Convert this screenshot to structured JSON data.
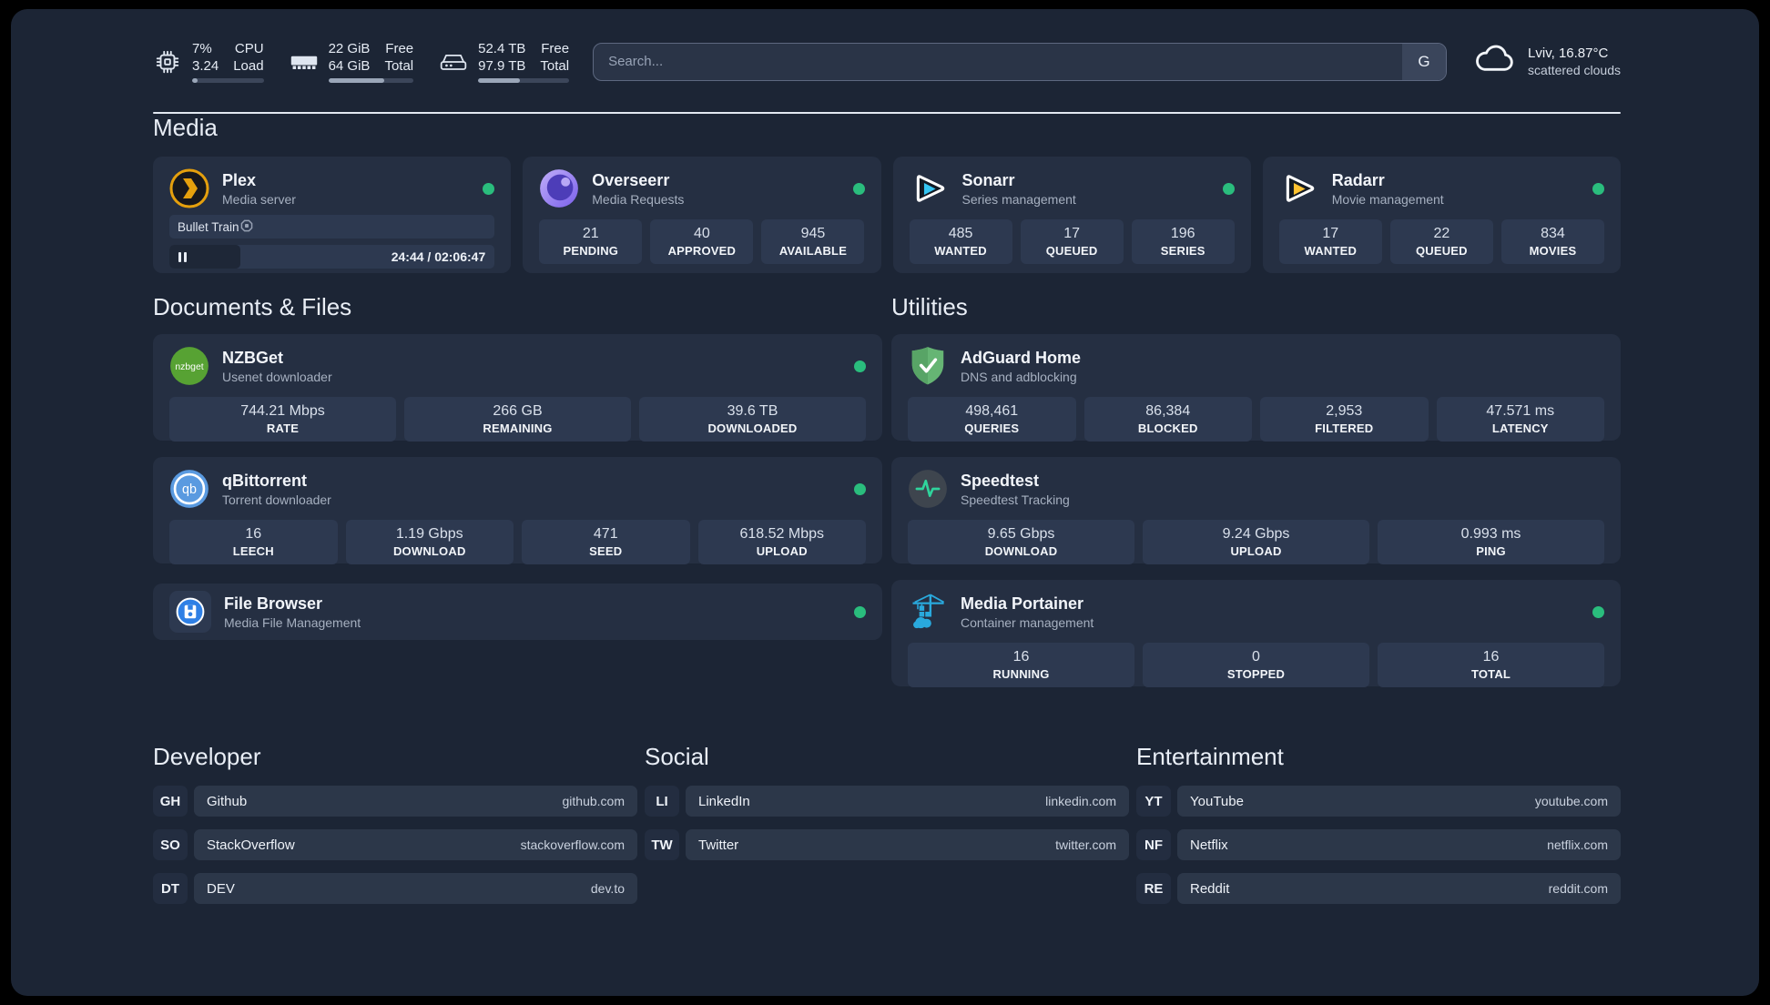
{
  "header": {
    "cpu": {
      "value_top": "7%",
      "value_bottom": "3.24",
      "label_top": "CPU",
      "label_bottom": "Load",
      "progress_pct": "7%"
    },
    "ram": {
      "value_top": "22 GiB",
      "value_bottom": "64 GiB",
      "label_top": "Free",
      "label_bottom": "Total",
      "progress_pct": "66%"
    },
    "disk": {
      "value_top": "52.4 TB",
      "value_bottom": "97.9 TB",
      "label_top": "Free",
      "label_bottom": "Total",
      "progress_pct": "46%"
    },
    "search": {
      "placeholder": "Search...",
      "button_label": "G"
    },
    "weather": {
      "location": "Lviv, 16.87°C",
      "condition": "scattered clouds"
    }
  },
  "sections": {
    "media": {
      "title": "Media",
      "apps": [
        {
          "name": "Plex",
          "description": "Media server",
          "online": true,
          "player": {
            "title": "Bullet Train",
            "time": "24:44 / 02:06:47"
          }
        },
        {
          "name": "Overseerr",
          "description": "Media Requests",
          "online": true,
          "stats": [
            {
              "value": "21",
              "label": "PENDING"
            },
            {
              "value": "40",
              "label": "APPROVED"
            },
            {
              "value": "945",
              "label": "AVAILABLE"
            }
          ]
        },
        {
          "name": "Sonarr",
          "description": "Series management",
          "online": true,
          "stats": [
            {
              "value": "485",
              "label": "WANTED"
            },
            {
              "value": "17",
              "label": "QUEUED"
            },
            {
              "value": "196",
              "label": "SERIES"
            }
          ]
        },
        {
          "name": "Radarr",
          "description": "Movie management",
          "online": true,
          "stats": [
            {
              "value": "17",
              "label": "WANTED"
            },
            {
              "value": "22",
              "label": "QUEUED"
            },
            {
              "value": "834",
              "label": "MOVIES"
            }
          ]
        }
      ]
    },
    "documents": {
      "title": "Documents & Files",
      "apps": [
        {
          "name": "NZBGet",
          "description": "Usenet downloader",
          "online": true,
          "stats": [
            {
              "value": "744.21 Mbps",
              "label": "RATE"
            },
            {
              "value": "266 GB",
              "label": "REMAINING"
            },
            {
              "value": "39.6 TB",
              "label": "DOWNLOADED"
            }
          ]
        },
        {
          "name": "qBittorrent",
          "description": "Torrent downloader",
          "online": true,
          "stats": [
            {
              "value": "16",
              "label": "LEECH"
            },
            {
              "value": "1.19 Gbps",
              "label": "DOWNLOAD"
            },
            {
              "value": "471",
              "label": "SEED"
            },
            {
              "value": "618.52 Mbps",
              "label": "UPLOAD"
            }
          ]
        },
        {
          "name": "File Browser",
          "description": "Media File Management",
          "online": true
        }
      ]
    },
    "utilities": {
      "title": "Utilities",
      "apps": [
        {
          "name": "AdGuard Home",
          "description": "DNS and adblocking",
          "stats": [
            {
              "value": "498,461",
              "label": "QUERIES"
            },
            {
              "value": "86,384",
              "label": "BLOCKED"
            },
            {
              "value": "2,953",
              "label": "FILTERED"
            },
            {
              "value": "47.571 ms",
              "label": "LATENCY"
            }
          ]
        },
        {
          "name": "Speedtest",
          "description": "Speedtest Tracking",
          "stats": [
            {
              "value": "9.65 Gbps",
              "label": "DOWNLOAD"
            },
            {
              "value": "9.24 Gbps",
              "label": "UPLOAD"
            },
            {
              "value": "0.993 ms",
              "label": "PING"
            }
          ]
        },
        {
          "name": "Media Portainer",
          "description": "Container management",
          "online": true,
          "stats": [
            {
              "value": "16",
              "label": "RUNNING"
            },
            {
              "value": "0",
              "label": "STOPPED"
            },
            {
              "value": "16",
              "label": "TOTAL"
            }
          ]
        }
      ]
    },
    "developer": {
      "title": "Developer",
      "links": [
        {
          "prefix": "GH",
          "name": "Github",
          "url": "github.com"
        },
        {
          "prefix": "SO",
          "name": "StackOverflow",
          "url": "stackoverflow.com"
        },
        {
          "prefix": "DT",
          "name": "DEV",
          "url": "dev.to"
        }
      ]
    },
    "social": {
      "title": "Social",
      "links": [
        {
          "prefix": "LI",
          "name": "LinkedIn",
          "url": "linkedin.com"
        },
        {
          "prefix": "TW",
          "name": "Twitter",
          "url": "twitter.com"
        }
      ]
    },
    "entertainment": {
      "title": "Entertainment",
      "links": [
        {
          "prefix": "YT",
          "name": "YouTube",
          "url": "youtube.com"
        },
        {
          "prefix": "NF",
          "name": "Netflix",
          "url": "netflix.com"
        },
        {
          "prefix": "RE",
          "name": "Reddit",
          "url": "reddit.com"
        }
      ]
    }
  },
  "colors": {
    "status_online": "#2abd7d",
    "plex_orange": "#e5a00d",
    "overseerr_purple": "#7a60ea",
    "sonarr_blue": "#35c5f1",
    "radarr_yellow": "#ffc230",
    "nzbget_green": "#57a233",
    "qbittorrent_blue": "#5a9ae0",
    "filebrowser_blue": "#2f80e5",
    "adguard_green": "#66b574",
    "speedtest_pulse": "#2fd49c",
    "portainer_blue": "#29a9dd"
  }
}
